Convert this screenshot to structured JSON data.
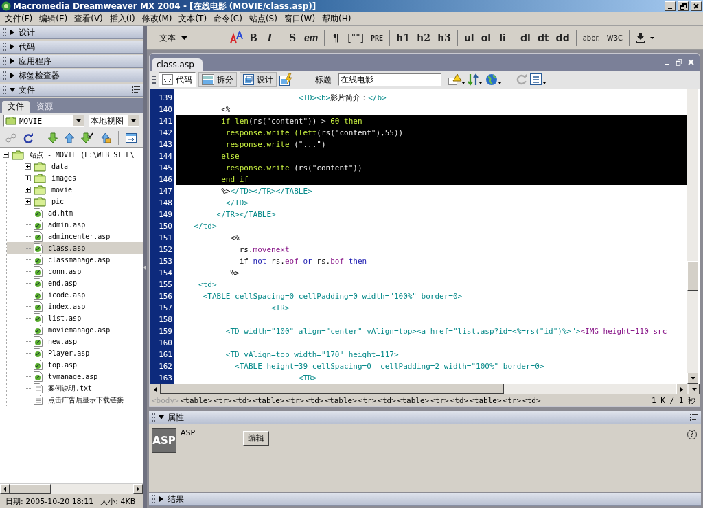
{
  "window": {
    "title": "Macromedia Dreamweaver MX 2004 - [在线电影 (MOVIE/class.asp)]"
  },
  "menu": [
    "文件(F)",
    "编辑(E)",
    "查看(V)",
    "插入(I)",
    "修改(M)",
    "文本(T)",
    "命令(C)",
    "站点(S)",
    "窗口(W)",
    "帮助(H)"
  ],
  "side_panels": [
    {
      "title": "设计",
      "expanded": false
    },
    {
      "title": "代码",
      "expanded": false
    },
    {
      "title": "应用程序",
      "expanded": false
    },
    {
      "title": "标签检查器",
      "expanded": false
    },
    {
      "title": "文件",
      "expanded": true
    }
  ],
  "files_panel": {
    "tabs": [
      {
        "label": "文件",
        "selected": true
      },
      {
        "label": "资源",
        "selected": false
      }
    ],
    "site_select": "MOVIE",
    "view_select": "本地视图",
    "tree": [
      {
        "label": "站点 - MOVIE (E:\\WEB SITE\\",
        "kind": "site",
        "expanded": true,
        "selected": false,
        "children": [
          {
            "label": "data",
            "kind": "folder",
            "expanded": false,
            "selected": false
          },
          {
            "label": "images",
            "kind": "folder",
            "expanded": false,
            "selected": false
          },
          {
            "label": "movie",
            "kind": "folder",
            "expanded": false,
            "selected": false
          },
          {
            "label": "pic",
            "kind": "folder",
            "expanded": false,
            "selected": false
          },
          {
            "label": "ad.htm",
            "kind": "file",
            "selected": false
          },
          {
            "label": "admin.asp",
            "kind": "file",
            "selected": false
          },
          {
            "label": "admincenter.asp",
            "kind": "file",
            "selected": false
          },
          {
            "label": "class.asp",
            "kind": "file",
            "selected": true
          },
          {
            "label": "classmanage.asp",
            "kind": "file",
            "selected": false
          },
          {
            "label": "conn.asp",
            "kind": "file",
            "selected": false
          },
          {
            "label": "end.asp",
            "kind": "file",
            "selected": false
          },
          {
            "label": "icode.asp",
            "kind": "file",
            "selected": false
          },
          {
            "label": "index.asp",
            "kind": "file",
            "selected": false
          },
          {
            "label": "list.asp",
            "kind": "file",
            "selected": false
          },
          {
            "label": "moviemanage.asp",
            "kind": "file",
            "selected": false
          },
          {
            "label": "new.asp",
            "kind": "file",
            "selected": false
          },
          {
            "label": "Player.asp",
            "kind": "file",
            "selected": false
          },
          {
            "label": "top.asp",
            "kind": "file",
            "selected": false
          },
          {
            "label": "tvmanage.asp",
            "kind": "file",
            "selected": false
          },
          {
            "label": "案例说明.txt",
            "kind": "text",
            "selected": false
          },
          {
            "label": "点击广告后显示下载链接",
            "kind": "text",
            "selected": false
          }
        ]
      }
    ],
    "status": {
      "date": "日期: 2005-10-20 18:11",
      "size": "大小: 4KB"
    }
  },
  "insert_bar": {
    "category": "文本",
    "groups": [
      [
        "B",
        "I"
      ],
      [
        "S",
        "em"
      ],
      [
        "¶",
        "[\"\"]",
        "PRE"
      ],
      [
        "h1",
        "h2",
        "h3"
      ],
      [
        "ul",
        "ol",
        "li"
      ],
      [
        "dl",
        "dt",
        "dd"
      ],
      [
        "abbr.",
        "W3C"
      ]
    ]
  },
  "document": {
    "tab": "class.asp",
    "views": [
      {
        "label": "代码",
        "selected": true
      },
      {
        "label": "拆分",
        "selected": false
      },
      {
        "label": "设计",
        "selected": false
      }
    ],
    "title_label": "标题",
    "title_value": "在线电影",
    "code_lines": [
      {
        "number": "139",
        "selected": false,
        "segments": [
          {
            "kind": "tag",
            "text": "                           <TD><b>"
          },
          {
            "kind": "plain",
            "text": "影片简介："
          },
          {
            "kind": "tag",
            "text": "</b>"
          }
        ]
      },
      {
        "number": "140",
        "selected": false,
        "segments": [
          {
            "kind": "plain",
            "text": "          <%"
          }
        ]
      },
      {
        "number": "141",
        "selected": true,
        "segments": [
          {
            "kind": "kw",
            "text": "          if len"
          },
          {
            "kind": "plain",
            "text": "(rs(\"content\")) > "
          },
          {
            "kind": "kw",
            "text": "60 then"
          }
        ]
      },
      {
        "number": "142",
        "selected": true,
        "segments": [
          {
            "kind": "kw",
            "text": "           response.write (left"
          },
          {
            "kind": "plain",
            "text": "(rs(\"content\"),55))"
          }
        ]
      },
      {
        "number": "143",
        "selected": true,
        "segments": [
          {
            "kind": "kw",
            "text": "           response.write "
          },
          {
            "kind": "plain",
            "text": "(\"...\")"
          }
        ]
      },
      {
        "number": "144",
        "selected": true,
        "segments": [
          {
            "kind": "kw",
            "text": "          else"
          }
        ]
      },
      {
        "number": "145",
        "selected": true,
        "segments": [
          {
            "kind": "kw",
            "text": "           response.write "
          },
          {
            "kind": "plain",
            "text": "(rs(\"content\"))"
          }
        ]
      },
      {
        "number": "146",
        "selected": true,
        "segments": [
          {
            "kind": "kw",
            "text": "          end if"
          }
        ]
      },
      {
        "number": "147",
        "selected": false,
        "segments": [
          {
            "kind": "plain",
            "text": "          %>"
          },
          {
            "kind": "tag",
            "text": "</TD></TR></TABLE>"
          }
        ]
      },
      {
        "number": "148",
        "selected": false,
        "segments": [
          {
            "kind": "tag",
            "text": "           </TD>"
          }
        ]
      },
      {
        "number": "149",
        "selected": false,
        "segments": [
          {
            "kind": "tag",
            "text": "         </TR></TABLE>"
          }
        ]
      },
      {
        "number": "150",
        "selected": false,
        "segments": [
          {
            "kind": "tag",
            "text": "    </td>"
          }
        ]
      },
      {
        "number": "151",
        "selected": false,
        "segments": [
          {
            "kind": "plain",
            "text": "            <%"
          }
        ]
      },
      {
        "number": "152",
        "selected": false,
        "segments": [
          {
            "kind": "plain",
            "text": "              rs."
          },
          {
            "kind": "member",
            "text": "movenext"
          }
        ]
      },
      {
        "number": "153",
        "selected": false,
        "segments": [
          {
            "kind": "plain",
            "text": "              if "
          },
          {
            "kind": "kw",
            "text": "not"
          },
          {
            "kind": "plain",
            "text": " rs."
          },
          {
            "kind": "member",
            "text": "eof"
          },
          {
            "kind": "kw",
            "text": " or"
          },
          {
            "kind": "plain",
            "text": " rs."
          },
          {
            "kind": "member",
            "text": "bof"
          },
          {
            "kind": "kw",
            "text": " then"
          }
        ]
      },
      {
        "number": "154",
        "selected": false,
        "segments": [
          {
            "kind": "plain",
            "text": "            %>"
          }
        ]
      },
      {
        "number": "155",
        "selected": false,
        "segments": [
          {
            "kind": "tag",
            "text": "     <td>"
          }
        ]
      },
      {
        "number": "156",
        "selected": false,
        "segments": [
          {
            "kind": "tag",
            "text": "      <TABLE cellSpacing=0 cellPadding=0 width=\"100%\" border=0>"
          }
        ]
      },
      {
        "number": "157",
        "selected": false,
        "segments": [
          {
            "kind": "tag",
            "text": "                     <TR>"
          }
        ]
      },
      {
        "number": "158",
        "selected": false
      },
      {
        "number": "159",
        "selected": false,
        "segments": [
          {
            "kind": "tag",
            "text": "           <TD width=\"100\" align=\"center\" vAlign=top><a href=\"list.asp?id=<%=rs(\"id\")%>\">"
          },
          {
            "kind": "member",
            "text": "<IMG height=110 src"
          }
        ]
      },
      {
        "number": "160",
        "selected": false
      },
      {
        "number": "161",
        "selected": false,
        "segments": [
          {
            "kind": "tag",
            "text": "           <TD vAlign=top width=\"170\" height=117>"
          }
        ]
      },
      {
        "number": "162",
        "selected": false,
        "segments": [
          {
            "kind": "tag",
            "text": "             <TABLE height=39 cellSpacing=0  cellPadding=2 width=\"100%\" border=0>"
          }
        ]
      },
      {
        "number": "163",
        "selected": false,
        "segments": [
          {
            "kind": "tag",
            "text": "                           <TR>"
          }
        ]
      }
    ],
    "tag_path": [
      {
        "text": "<body>",
        "disabled": true
      },
      {
        "text": "<table>",
        "disabled": false
      },
      {
        "text": "<tr>",
        "disabled": false
      },
      {
        "text": "<td>",
        "disabled": false
      },
      {
        "text": "<table>",
        "disabled": false
      },
      {
        "text": "<tr>",
        "disabled": false
      },
      {
        "text": "<td>",
        "disabled": false
      },
      {
        "text": "<table>",
        "disabled": false
      },
      {
        "text": "<tr>",
        "disabled": false
      },
      {
        "text": "<td>",
        "disabled": false
      },
      {
        "text": "<table>",
        "disabled": false
      },
      {
        "text": "<tr>",
        "disabled": false
      },
      {
        "text": "<td>",
        "disabled": false
      },
      {
        "text": "<table>",
        "disabled": false
      },
      {
        "text": "<tr>",
        "disabled": false
      },
      {
        "text": "<td>",
        "disabled": false
      }
    ],
    "size_time": "1 K / 1 秒"
  },
  "properties": {
    "title": "属性",
    "expanded": true,
    "icon_text": "ASP",
    "type_label": "ASP",
    "edit_button": "编辑",
    "help": "?"
  },
  "results": {
    "title": "结果",
    "expanded": false
  }
}
